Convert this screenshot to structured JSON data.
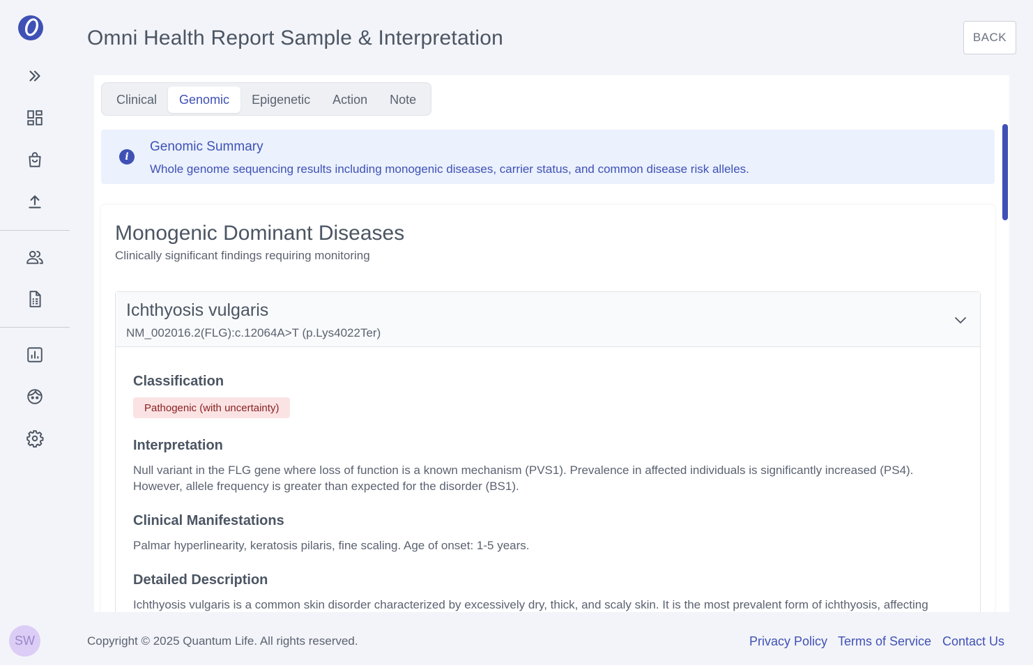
{
  "app": {
    "title": "Omni Health Report Sample & Interpretation",
    "back_label": "BACK",
    "avatar_initials": "SW"
  },
  "sidebar": {
    "icons": [
      "expand-icon",
      "dashboard-icon",
      "shopping-bag-icon",
      "upload-icon",
      "users-icon",
      "document-icon",
      "chart-icon",
      "face-icon",
      "gear-icon"
    ]
  },
  "tabs": [
    {
      "label": "Clinical",
      "active": false
    },
    {
      "label": "Genomic",
      "active": true
    },
    {
      "label": "Epigenetic",
      "active": false
    },
    {
      "label": "Action",
      "active": false
    },
    {
      "label": "Note",
      "active": false
    }
  ],
  "info": {
    "title": "Genomic Summary",
    "text": "Whole genome sequencing results including monogenic diseases, carrier status, and common disease risk alleles."
  },
  "section": {
    "title": "Monogenic Dominant Diseases",
    "subtitle": "Clinically significant findings requiring monitoring"
  },
  "finding": {
    "name": "Ichthyosis vulgaris",
    "variant": "NM_002016.2(FLG):c.12064A>T (p.Lys4022Ter)",
    "classification_label": "Classification",
    "classification": "Pathogenic (with uncertainty)",
    "interpretation_label": "Interpretation",
    "interpretation": "Null variant in the FLG gene where loss of function is a known mechanism (PVS1). Prevalence in affected individuals is significantly increased (PS4). However, allele frequency is greater than expected for the disorder (BS1).",
    "manifestations_label": "Clinical Manifestations",
    "manifestations": "Palmar hyperlinearity, keratosis pilaris, fine scaling. Age of onset: 1-5 years.",
    "description_label": "Detailed Description",
    "description": "Ichthyosis vulgaris is a common skin disorder characterized by excessively dry, thick, and scaly skin. It is the most prevalent form of ichthyosis, affecting"
  },
  "footer": {
    "copyright": "Copyright © 2025 Quantum Life. All rights reserved.",
    "privacy": "Privacy Policy",
    "terms": "Terms of Service",
    "contact": "Contact Us"
  },
  "colors": {
    "accent": "#3f51b5",
    "background": "#f3f4f9",
    "badge_bg": "#fbe3e4",
    "badge_text": "#8a2020",
    "info_bg": "#ebf1fd"
  }
}
